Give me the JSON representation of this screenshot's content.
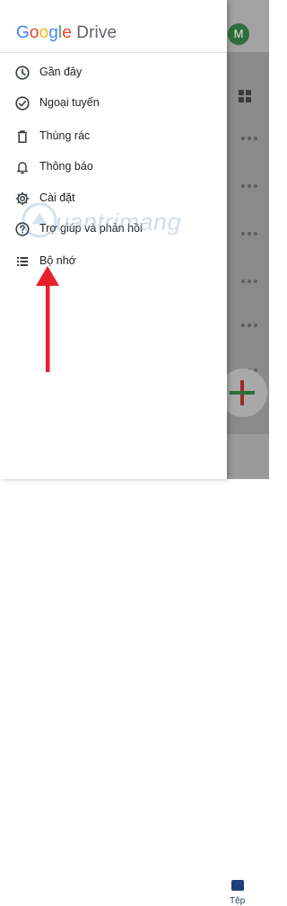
{
  "background": {
    "avatar_letter": "M",
    "bottom_nav_label": "Tệp"
  },
  "drawer": {
    "logo": {
      "google": [
        "G",
        "o",
        "o",
        "g",
        "l",
        "e"
      ],
      "product": "Drive"
    },
    "items": [
      {
        "label": "Gần đây",
        "icon": "clock-icon"
      },
      {
        "label": "Ngoại tuyến",
        "icon": "offline-check-icon"
      },
      {
        "label": "Thùng rác",
        "icon": "trash-icon"
      },
      {
        "label": "Thông báo",
        "icon": "bell-icon"
      },
      {
        "label": "Cài đặt",
        "icon": "gear-icon"
      },
      {
        "label": "Trợ giúp và phản hồi",
        "icon": "help-icon"
      },
      {
        "label": "Bộ nhớ",
        "icon": "storage-list-icon"
      }
    ]
  },
  "watermark": "uantrimang",
  "colors": {
    "arrow": "#e8202a",
    "text": "#202124",
    "icon": "#3c4043"
  }
}
